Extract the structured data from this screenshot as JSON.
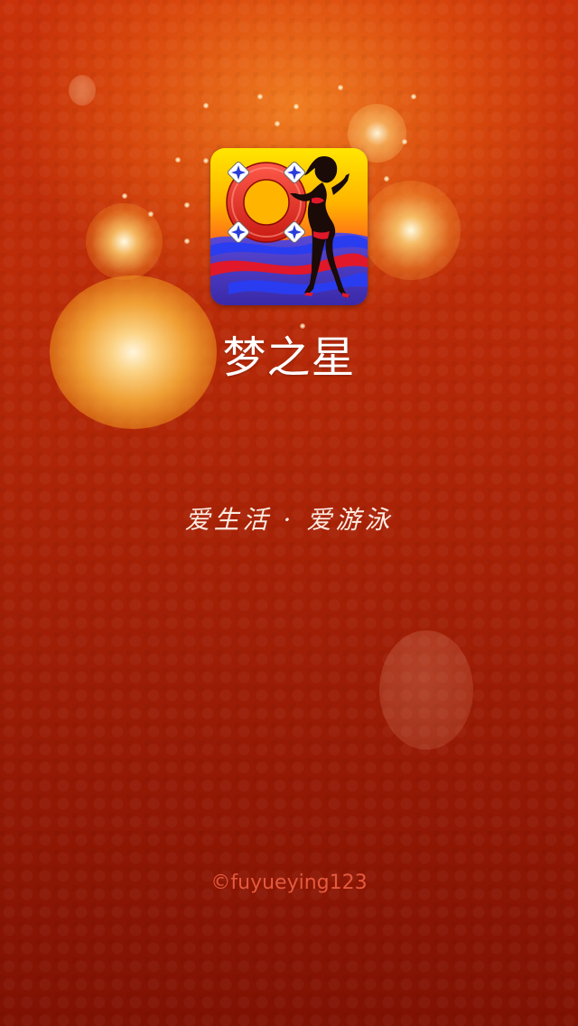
{
  "splash": {
    "app_name": "梦之星",
    "slogan": "爱生活 · 爱游泳",
    "copyright": "©fuyueying123",
    "icon": "app-icon-lifebuoy-swimmer"
  },
  "colors": {
    "background_top": "#c9320a",
    "background_bottom": "#801203",
    "app_name_text": "#ffffff",
    "slogan_text": "#fbece2",
    "copyright_text": "#e45a3e"
  }
}
